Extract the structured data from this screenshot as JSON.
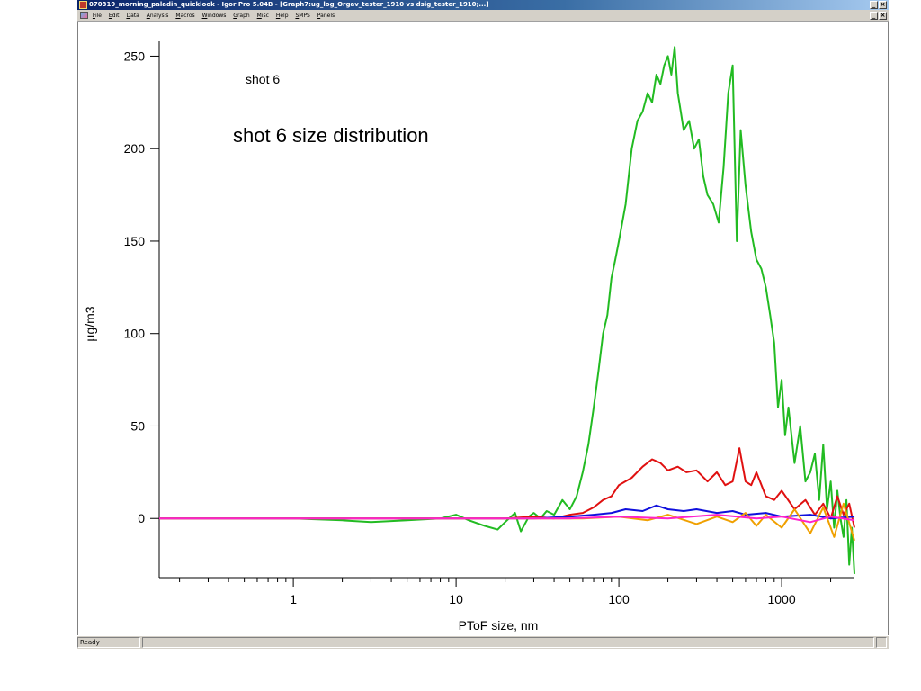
{
  "window": {
    "title": "070319_morning_paladin_quicklook - Igor Pro 5.04B - [Graph7:ug_log_Orgav_tester_1910 vs dsig_tester_1910;...]",
    "controls": [
      "_",
      "×"
    ],
    "doc_controls": [
      "_",
      "×"
    ]
  },
  "menubar": {
    "items": [
      "File",
      "Edit",
      "Data",
      "Analysis",
      "Macros",
      "Windows",
      "Graph",
      "Misc",
      "Help",
      "SMPS",
      "Panels"
    ]
  },
  "status": {
    "text": "Ready"
  },
  "chart_data": {
    "type": "line",
    "xlabel": "PToF size, nm",
    "ylabel": "µg/m3",
    "x_scale": "log",
    "xlim": [
      0.15,
      2800
    ],
    "ylim": [
      -32,
      258
    ],
    "x_ticks": [
      1,
      10,
      100,
      1000
    ],
    "x_tick_labels": [
      "1",
      "10",
      "100",
      "1000"
    ],
    "y_ticks": [
      0,
      50,
      100,
      150,
      200,
      250
    ],
    "y_tick_labels": [
      "0",
      "50",
      "100",
      "150",
      "200",
      "250"
    ],
    "annotations": [
      "shot 6",
      "shot 6 size distribution"
    ],
    "grid": false,
    "series": [
      {
        "color": "#22bb22",
        "x": [
          0.15,
          1,
          2,
          3,
          5,
          8,
          10,
          12,
          15,
          18,
          20,
          23,
          25,
          28,
          30,
          33,
          36,
          40,
          45,
          50,
          55,
          60,
          65,
          70,
          75,
          80,
          85,
          90,
          95,
          100,
          110,
          120,
          130,
          140,
          150,
          160,
          170,
          180,
          190,
          200,
          210,
          220,
          230,
          240,
          250,
          270,
          290,
          310,
          330,
          350,
          380,
          410,
          440,
          470,
          500,
          530,
          560,
          600,
          650,
          700,
          750,
          800,
          850,
          900,
          950,
          1000,
          1050,
          1100,
          1200,
          1300,
          1400,
          1500,
          1600,
          1700,
          1800,
          1900,
          2000,
          2100,
          2200,
          2300,
          2400,
          2500,
          2600,
          2700,
          2800
        ],
        "values": [
          0,
          0,
          -1,
          -2,
          -1,
          0,
          2,
          -1,
          -4,
          -6,
          -2,
          3,
          -7,
          1,
          3,
          0,
          4,
          2,
          10,
          5,
          12,
          25,
          40,
          60,
          80,
          100,
          110,
          130,
          140,
          150,
          170,
          200,
          215,
          220,
          230,
          225,
          240,
          235,
          245,
          250,
          240,
          255,
          230,
          220,
          210,
          215,
          200,
          205,
          185,
          175,
          170,
          160,
          190,
          230,
          245,
          150,
          210,
          180,
          155,
          140,
          135,
          125,
          110,
          95,
          60,
          75,
          45,
          60,
          30,
          50,
          20,
          25,
          35,
          10,
          40,
          5,
          20,
          -5,
          15,
          0,
          -10,
          10,
          -25,
          -5,
          -30
        ]
      },
      {
        "color": "#e01010",
        "x": [
          0.15,
          10,
          20,
          30,
          40,
          50,
          60,
          70,
          80,
          90,
          100,
          120,
          140,
          160,
          180,
          200,
          230,
          260,
          300,
          350,
          400,
          450,
          500,
          550,
          600,
          650,
          700,
          800,
          900,
          1000,
          1200,
          1400,
          1600,
          1800,
          2000,
          2200,
          2400,
          2600,
          2800
        ],
        "values": [
          0,
          0,
          0,
          1,
          0,
          2,
          3,
          6,
          10,
          12,
          18,
          22,
          28,
          32,
          30,
          26,
          28,
          25,
          26,
          20,
          25,
          18,
          20,
          38,
          20,
          18,
          25,
          12,
          10,
          15,
          5,
          10,
          2,
          8,
          0,
          12,
          2,
          8,
          -5
        ]
      },
      {
        "color": "#1010dd",
        "x": [
          0.15,
          10,
          30,
          50,
          70,
          90,
          110,
          140,
          170,
          200,
          250,
          300,
          400,
          500,
          600,
          800,
          1000,
          1500,
          2000,
          2800
        ],
        "values": [
          0,
          0,
          0,
          1,
          2,
          3,
          5,
          4,
          7,
          5,
          4,
          5,
          3,
          4,
          2,
          3,
          1,
          2,
          0,
          1
        ]
      },
      {
        "color": "#f0a000",
        "x": [
          0.15,
          10,
          30,
          60,
          100,
          150,
          200,
          300,
          400,
          500,
          600,
          700,
          800,
          1000,
          1200,
          1500,
          1800,
          2100,
          2400,
          2800
        ],
        "values": [
          0,
          0,
          0,
          0,
          1,
          -1,
          2,
          -3,
          1,
          -2,
          3,
          -4,
          2,
          -5,
          5,
          -8,
          6,
          -10,
          8,
          -12
        ]
      },
      {
        "color": "#ff22cc",
        "x": [
          0.15,
          1,
          10,
          50,
          100,
          200,
          400,
          700,
          1000,
          1500,
          2000,
          2800
        ],
        "values": [
          0,
          0,
          0,
          0,
          1,
          0,
          2,
          0,
          1,
          -2,
          1,
          -1
        ]
      }
    ]
  }
}
